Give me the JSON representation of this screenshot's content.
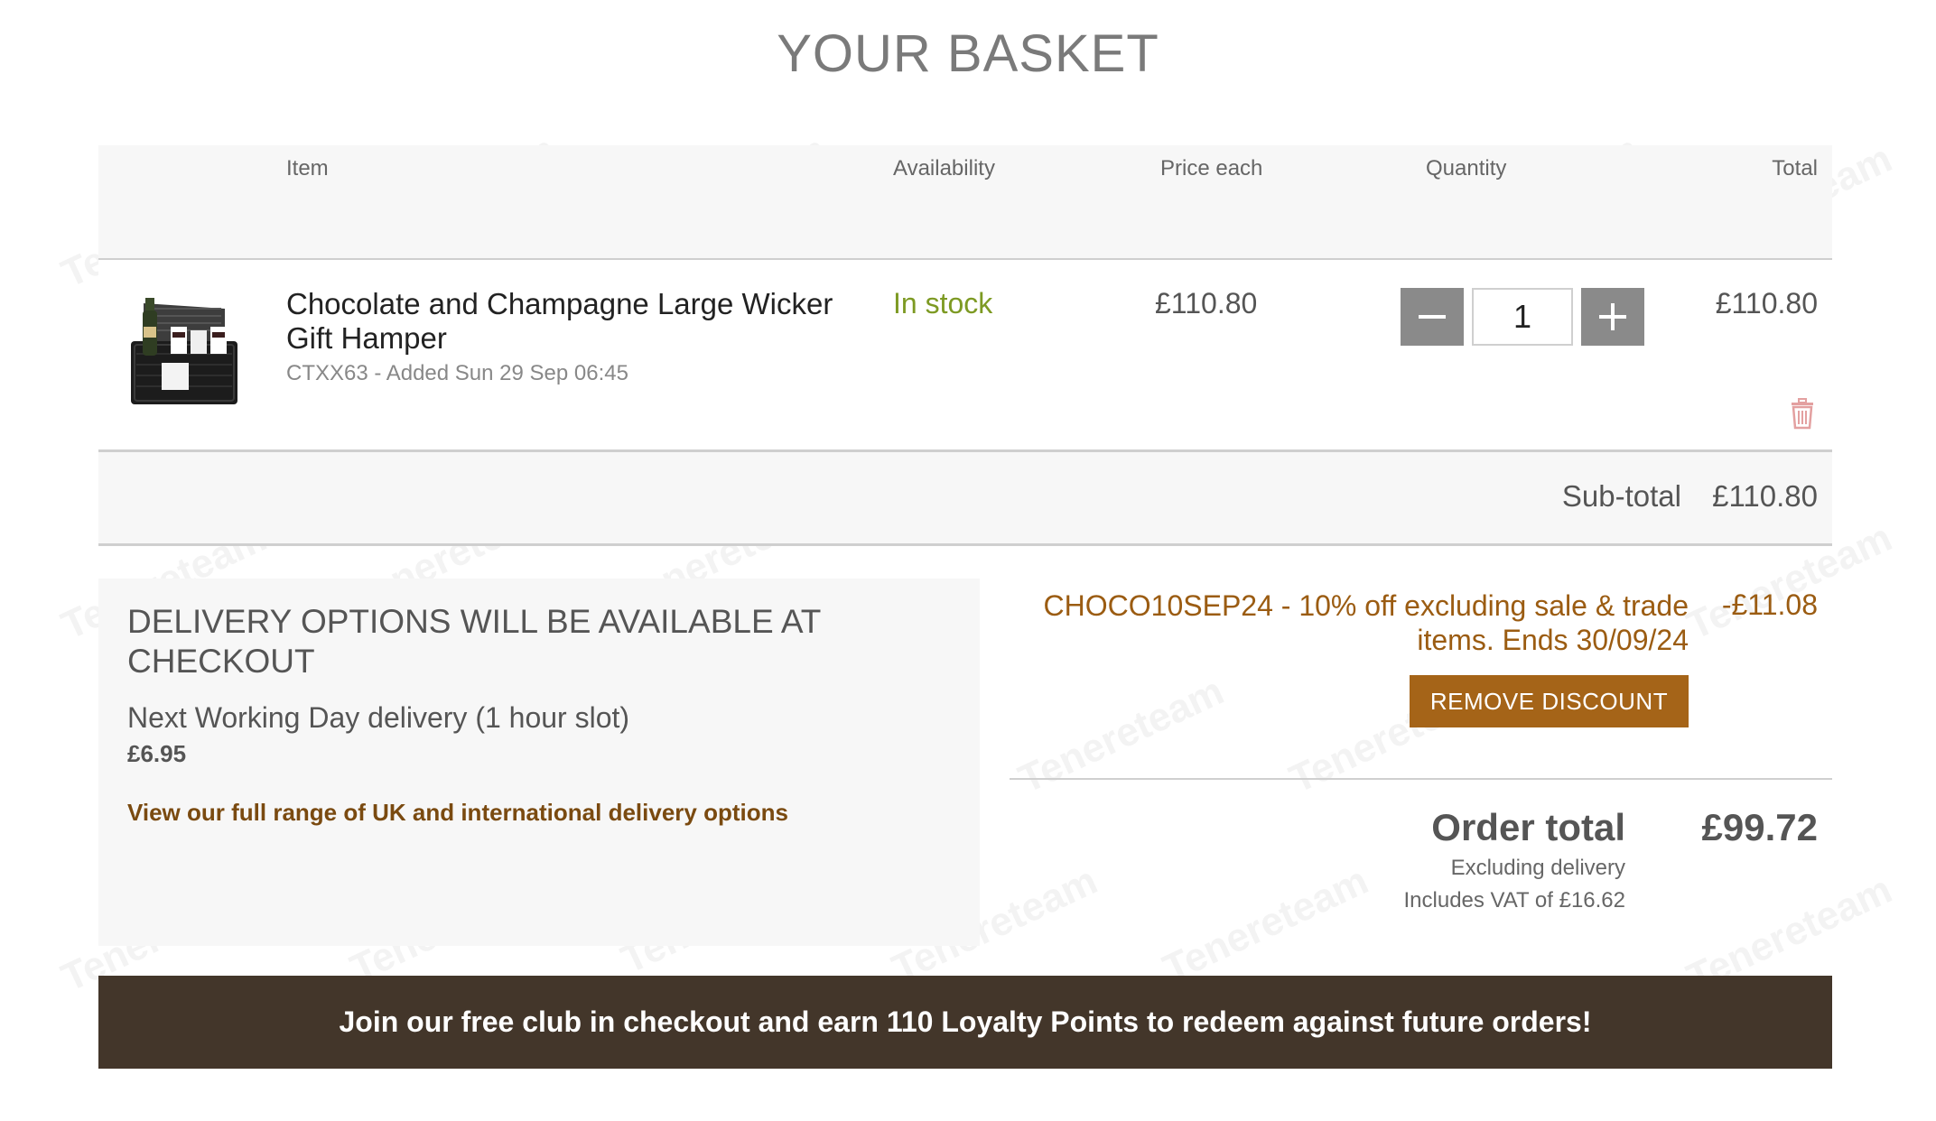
{
  "page": {
    "title": "YOUR BASKET"
  },
  "table": {
    "headers": {
      "item": "Item",
      "availability": "Availability",
      "price_each": "Price each",
      "quantity": "Quantity",
      "total": "Total"
    },
    "rows": [
      {
        "name": "Chocolate and Champagne Large Wicker Gift Hamper",
        "meta": "CTXX63 - Added Sun 29 Sep 06:45",
        "availability": "In stock",
        "price_each": "£110.80",
        "quantity": "1",
        "total": "£110.80",
        "thumbnail_icon": "wicker-hamper-image"
      }
    ],
    "subtotal": {
      "label": "Sub-total",
      "value": "£110.80"
    }
  },
  "delivery": {
    "heading": "DELIVERY OPTIONS WILL BE AVAILABLE AT CHECKOUT",
    "option_name": "Next Working Day delivery (1 hour slot)",
    "option_price": "£6.95",
    "link_text": "View our full range of UK and international delivery options"
  },
  "discount": {
    "text": "CHOCO10SEP24 - 10% off excluding sale & trade items. Ends 30/09/24",
    "value": "-£11.08",
    "remove_label": "REMOVE DISCOUNT"
  },
  "order_total": {
    "label": "Order total",
    "value": "£99.72",
    "excluding": "Excluding delivery",
    "vat": "Includes VAT of £16.62"
  },
  "banner": {
    "text": "Join our free club in checkout and earn 110 Loyalty Points to redeem against future orders!"
  },
  "watermark": {
    "text": "Tenereteam"
  },
  "colors": {
    "accent_brown": "#a56418",
    "discount_text": "#9b5c12",
    "in_stock_green": "#7d9a23",
    "banner_bg": "#43362a",
    "qty_button": "#8a8a8a",
    "trash_icon": "#e3a0a0"
  }
}
